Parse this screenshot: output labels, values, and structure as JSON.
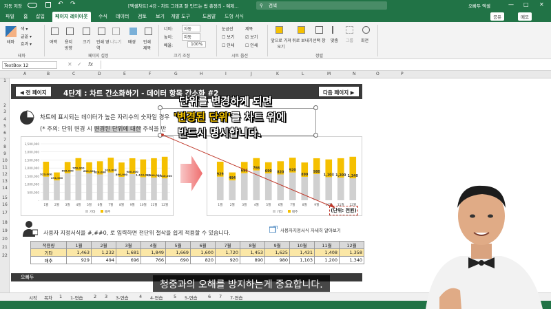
{
  "titlebar": {
    "autosave": "자동 저장",
    "filename": "[엑셀차트] 4강 - 차트 그래프 잘 만드는 법 총정리 - 예제...",
    "search": "검색",
    "user": "오빠두 엑셀"
  },
  "tabs": [
    "파일",
    "홈",
    "삽입",
    "페이지 레이아웃",
    "수식",
    "데이터",
    "검토",
    "보기",
    "개발 도구",
    "도움말",
    "도형 서식"
  ],
  "share": "공유",
  "comment": "메모",
  "ribbon": {
    "groups": [
      "테마",
      "페이지 설정",
      "크기 조정",
      "시트 옵션",
      "정렬"
    ],
    "theme_items": [
      "테마",
      "색 ▾",
      "글꼴 ▾",
      "효과 ▾"
    ],
    "page_items": [
      "여백",
      "용지 방향",
      "크기",
      "인쇄 영역",
      "나누기",
      "배경",
      "인쇄 제목"
    ],
    "scale_items": [
      "너비:",
      "자동",
      "높이:",
      "자동",
      "배율:",
      "100%"
    ],
    "sheet_items": [
      "눈금선",
      "보기",
      "인쇄",
      "제목",
      "보기",
      "인쇄"
    ],
    "arrange_items": [
      "앞으로 가져오기",
      "뒤로 보내기",
      "선택 창",
      "맞춤",
      "그룹",
      "회전"
    ]
  },
  "namebox": "TextBox 12",
  "fx": "fx",
  "columns": [
    "A",
    "B",
    "C",
    "D",
    "E",
    "F",
    "G",
    "H",
    "I",
    "J",
    "K",
    "L",
    "M",
    "N",
    "O",
    "P"
  ],
  "rows": [
    "1",
    "2",
    "3",
    "4",
    "5",
    "6",
    "7",
    "8",
    "9",
    "10",
    "11",
    "12",
    "13",
    "14",
    "15",
    "16",
    "17",
    "18",
    "19",
    "20",
    "21",
    "22"
  ],
  "banner": {
    "prev": "◀ 전 페이지",
    "title": "4단계 : 차트 간소화하기 - 데이터 항목 간소화 #2",
    "next": "다음 페이지 ▶"
  },
  "body": {
    "line1": "차트에 표시되는 데이터가 높은 자리수의 숫자일 경우",
    "line2_prefix": "(* 주의: 단위 변경 시",
    "line2_hl": "변경된 단위에 대한",
    "line2_suffix": "주석을 반",
    "line3": "사용자 지정서식을 #,##0, 로 입력하면 천단위 절삭을 쉽게 적용할 수 있습니다.",
    "link": "사용자지정서식 자세히 알아보기"
  },
  "overlay": {
    "l1": "단위를 변경하게 되면",
    "l2a": "'변경된 단위'",
    "l2b": "를 차트 위에",
    "l3": "반드시 명시합니다."
  },
  "unit_label": "(단위: 천원)",
  "chart_data": [
    {
      "type": "bar",
      "stacked": true,
      "categories": [
        "1월",
        "2월",
        "3월",
        "4월",
        "5월",
        "6월",
        "7월",
        "8월",
        "9월",
        "10월",
        "11월",
        "12월"
      ],
      "series": [
        {
          "name": "기타",
          "values": [
            1463,
            1232,
            1681,
            1849,
            1669,
            1600,
            1720,
            1453,
            1625,
            1431,
            1408,
            1358
          ],
          "color": "#d0d0d0"
        },
        {
          "name": "배추",
          "values": [
            929,
            494,
            696,
            766,
            690,
            820,
            920,
            890,
            980,
            1103,
            1200,
            1340
          ],
          "color": "#f5c000"
        }
      ],
      "yticks": [
        "3,500,000",
        "3,000,000",
        "2,500,000",
        "2,000,000",
        "1,500,000",
        "1,000,000",
        "500,000",
        "-"
      ],
      "data_labels": [
        "929,000",
        "494,000",
        "696,000",
        "766,000",
        "690,000",
        "820,000",
        "920,000",
        "890,000",
        "980,000",
        "1,103,000",
        "1,200,000",
        "1,340,000"
      ]
    },
    {
      "type": "bar",
      "stacked": true,
      "categories": [
        "1월",
        "2월",
        "3월",
        "4월",
        "5월",
        "6월",
        "7월",
        "8월",
        "9월",
        "10월",
        "11월",
        "12월"
      ],
      "series": [
        {
          "name": "기타",
          "values": [
            1463,
            1232,
            1681,
            1849,
            1669,
            1600,
            1720,
            1453,
            1625,
            1431,
            1408,
            1358
          ],
          "color": "#d0d0d0"
        },
        {
          "name": "배추",
          "values": [
            929,
            494,
            696,
            766,
            690,
            820,
            920,
            890,
            980,
            1103,
            1200,
            1340
          ],
          "color": "#f5c000"
        }
      ],
      "data_labels": [
        "929",
        "494",
        "696",
        "766",
        "690",
        "820",
        "920",
        "890",
        "980",
        "1,103",
        "1,200",
        "1,340"
      ]
    }
  ],
  "table": {
    "header": [
      "적용량",
      "1월",
      "2월",
      "3월",
      "4월",
      "5월",
      "6월",
      "7월",
      "8월",
      "9월",
      "10월",
      "11월",
      "12월"
    ],
    "rows": [
      {
        "label": "기타",
        "values": [
          "1,463",
          "1,232",
          "1,681",
          "1,849",
          "1,669",
          "1,600",
          "1,720",
          "1,453",
          "1,625",
          "1,431",
          "1,408",
          "1,358"
        ]
      },
      {
        "label": "배추",
        "values": [
          "929",
          "494",
          "696",
          "766",
          "690",
          "820",
          "920",
          "890",
          "980",
          "1,103",
          "1,200",
          "1,340"
        ]
      }
    ]
  },
  "footer": "오빠두",
  "sheet_tabs": [
    "시작",
    "목차",
    "1",
    "1-연습",
    "2",
    "3",
    "3-연습",
    "4",
    "4-연습",
    "5",
    "5-연습",
    "6",
    "7",
    "7-연습"
  ],
  "subtitle": "청중과의 오해를 방지하는게 중요합니다."
}
